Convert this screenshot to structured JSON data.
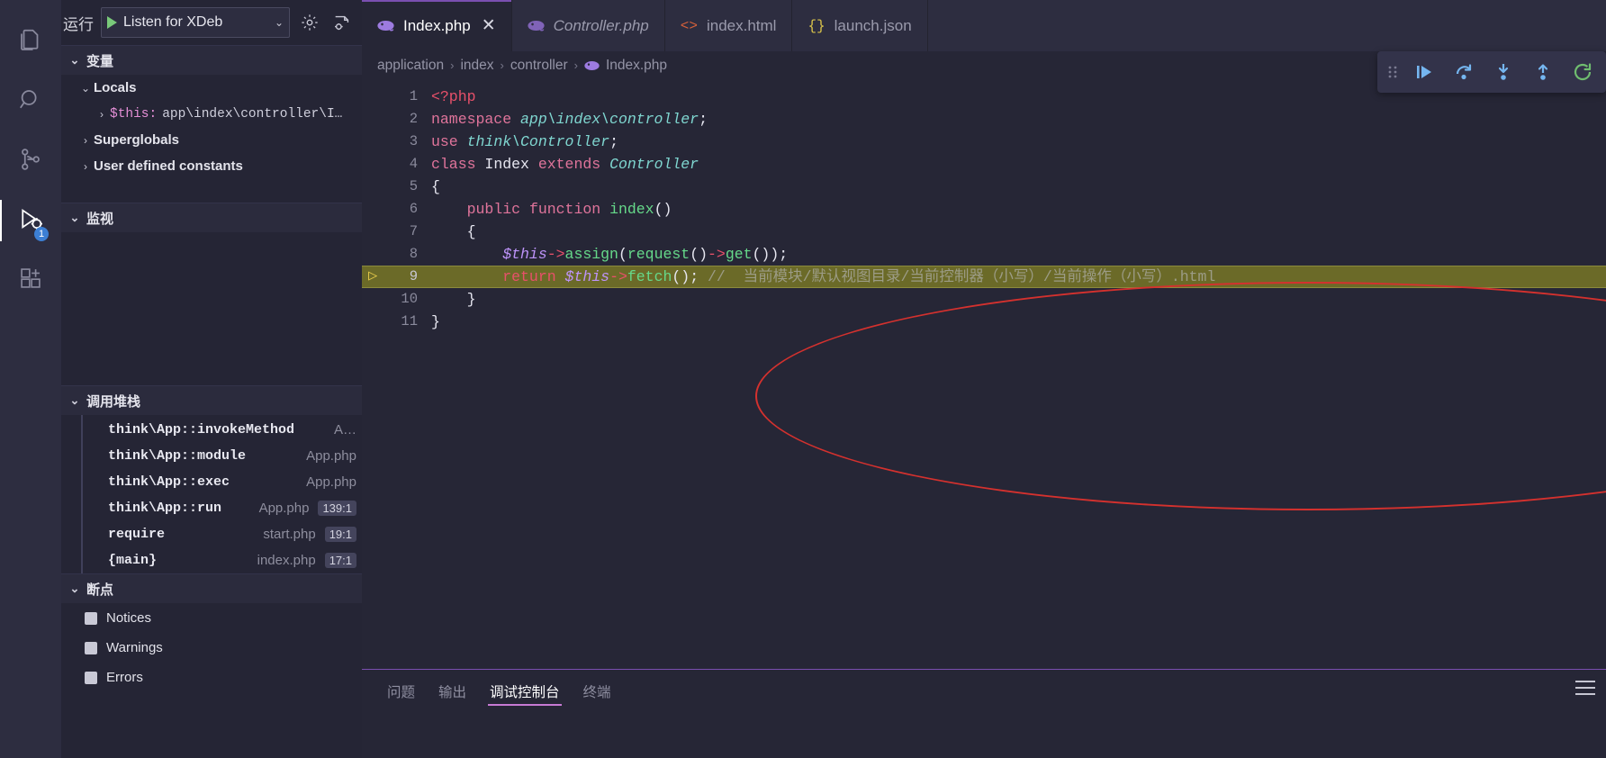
{
  "activity_bar": {
    "items": [
      {
        "name": "explorer",
        "icon": "files-icon",
        "active": false
      },
      {
        "name": "search",
        "icon": "search-icon",
        "active": false
      },
      {
        "name": "source-control",
        "icon": "source-control-icon",
        "active": false
      },
      {
        "name": "run-and-debug",
        "icon": "debug-icon",
        "active": true,
        "badge": "1"
      },
      {
        "name": "extensions",
        "icon": "extensions-icon",
        "active": false
      }
    ]
  },
  "debug_sidebar": {
    "run_label": "运行",
    "launch_config": "Listen for XDeb",
    "chevron": "⌄",
    "gear_icon": "gear-icon",
    "open_debug_icon": "open-debug-console-icon",
    "sections": {
      "variables": {
        "title": "变量",
        "twisty": "⌄",
        "rows": [
          {
            "indent": 1,
            "twisty": "⌄",
            "label": "Locals",
            "value": "",
            "style": "bold"
          },
          {
            "indent": 2,
            "twisty": "›",
            "label": "$this:",
            "value": "app\\index\\controller\\I…",
            "style": "var"
          },
          {
            "indent": 1,
            "twisty": "›",
            "label": "Superglobals",
            "value": "",
            "style": "bold"
          },
          {
            "indent": 1,
            "twisty": "›",
            "label": "User defined constants",
            "value": "",
            "style": "bold"
          }
        ]
      },
      "watch": {
        "title": "监视",
        "twisty": "⌄",
        "rows": []
      },
      "call_stack": {
        "title": "调用堆栈",
        "twisty": "⌄",
        "rows": [
          {
            "fn": "think\\App::invokeMethod",
            "file": "A…",
            "line": ""
          },
          {
            "fn": "think\\App::module",
            "file": "App.php",
            "line": ""
          },
          {
            "fn": "think\\App::exec",
            "file": "App.php",
            "line": ""
          },
          {
            "fn": "think\\App::run",
            "file": "App.php",
            "line": "139:1"
          },
          {
            "fn": "require",
            "file": "start.php",
            "line": "19:1"
          },
          {
            "fn": "{main}",
            "file": "index.php",
            "line": "17:1"
          }
        ]
      },
      "breakpoints": {
        "title": "断点",
        "twisty": "⌄",
        "rows": [
          {
            "label": "Notices",
            "checked": true
          },
          {
            "label": "Warnings",
            "checked": true
          },
          {
            "label": "Errors",
            "checked": true
          }
        ]
      }
    }
  },
  "editor": {
    "tabs": [
      {
        "label": "Index.php",
        "icon": "php-icon",
        "active": true,
        "closable": true,
        "close_glyph": "✕",
        "italic": false
      },
      {
        "label": "Controller.php",
        "icon": "php-icon",
        "active": false,
        "closable": false,
        "close_glyph": "",
        "italic": true
      },
      {
        "label": "index.html",
        "icon": "html-icon",
        "active": false,
        "closable": false,
        "close_glyph": "",
        "italic": false
      },
      {
        "label": "launch.json",
        "icon": "json-icon",
        "active": false,
        "closable": false,
        "close_glyph": "",
        "italic": false
      }
    ],
    "breadcrumbs": [
      {
        "label": "application",
        "icon": ""
      },
      {
        "label": "index",
        "icon": ""
      },
      {
        "label": "controller",
        "icon": ""
      },
      {
        "label": "Index.php",
        "icon": "php-icon"
      }
    ],
    "breadcrumb_separator": "›",
    "lines": [
      {
        "num": "1",
        "highlight": false,
        "breakpoint": false
      },
      {
        "num": "2",
        "highlight": false,
        "breakpoint": false
      },
      {
        "num": "3",
        "highlight": false,
        "breakpoint": false
      },
      {
        "num": "4",
        "highlight": false,
        "breakpoint": false
      },
      {
        "num": "5",
        "highlight": false,
        "breakpoint": false
      },
      {
        "num": "6",
        "highlight": false,
        "breakpoint": false
      },
      {
        "num": "7",
        "highlight": false,
        "breakpoint": false
      },
      {
        "num": "8",
        "highlight": false,
        "breakpoint": false
      },
      {
        "num": "9",
        "highlight": true,
        "breakpoint": true
      },
      {
        "num": "10",
        "highlight": false,
        "breakpoint": false
      },
      {
        "num": "11",
        "highlight": false,
        "breakpoint": false
      }
    ],
    "code_text": {
      "l1_tag": "<?php",
      "l2_kw": "namespace",
      "l2_ns": "app\\index\\controller",
      "l2_semi": ";",
      "l3_kw": "use",
      "l3_ns": "think\\Controller",
      "l3_semi": ";",
      "l4_kw": "class",
      "l4_name": "Index",
      "l4_kw2": "extends",
      "l4_parent": "Controller",
      "l5_brace": "{",
      "l6_kw": "public",
      "l6_kw2": "function",
      "l6_fn": "index",
      "l6_paren": "()",
      "l7_brace": "{",
      "l8_var": "$this",
      "l8_arrow": "->",
      "l8_fn": "assign",
      "l8_open": "(",
      "l8_fn2": "request",
      "l8_mid": "()",
      "l8_arrow2": "->",
      "l8_fn3": "get",
      "l8_end": "());",
      "l9_kw": "return",
      "l9_var": "$this",
      "l9_arrow": "->",
      "l9_fn": "fetch",
      "l9_end": "();",
      "l9_comment": "//  当前模块/默认视图目录/当前控制器（小写）/当前操作（小写）.html",
      "l10_brace": "}",
      "l11_brace": "}"
    },
    "annotation": {
      "shape": "ellipse",
      "color": "#d4312e"
    }
  },
  "debug_toolbar": {
    "buttons": [
      {
        "name": "drag-grip",
        "icon": "grip-icon"
      },
      {
        "name": "continue",
        "icon": "continue-icon"
      },
      {
        "name": "step-over",
        "icon": "step-over-icon"
      },
      {
        "name": "step-into",
        "icon": "step-into-icon"
      },
      {
        "name": "step-out",
        "icon": "step-out-icon"
      },
      {
        "name": "restart",
        "icon": "restart-icon"
      }
    ]
  },
  "panel": {
    "tabs": [
      {
        "label": "问题",
        "active": false
      },
      {
        "label": "输出",
        "active": false
      },
      {
        "label": "调试控制台",
        "active": true
      },
      {
        "label": "终端",
        "active": false
      }
    ],
    "menu_icon": "more-actions-icon"
  }
}
